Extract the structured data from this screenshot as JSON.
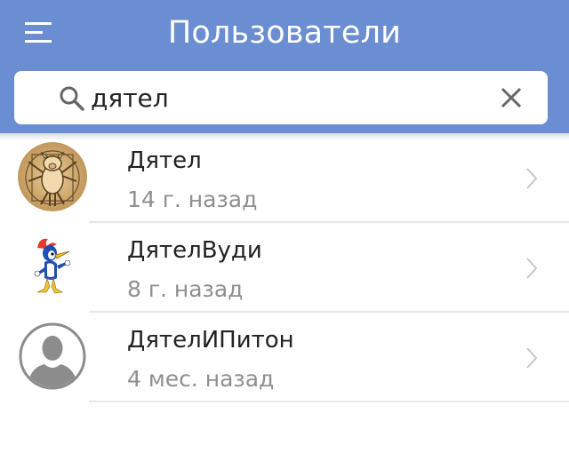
{
  "header": {
    "title": "Пользователи",
    "menu_icon": "hamburger-menu-icon",
    "background_color": "#6a8ed1"
  },
  "search": {
    "icon": "search-icon",
    "value": "дятел",
    "clear_icon": "close-icon"
  },
  "users": [
    {
      "name": "Дятел",
      "last_seen": "14 г. назад",
      "avatar": "pig-drawing-avatar"
    },
    {
      "name": "ДятелВуди",
      "last_seen": "8 г. назад",
      "avatar": "woodpecker-cartoon-avatar"
    },
    {
      "name": "ДятелИПитон",
      "last_seen": "4 мес. назад",
      "avatar": "default-person-avatar"
    }
  ]
}
